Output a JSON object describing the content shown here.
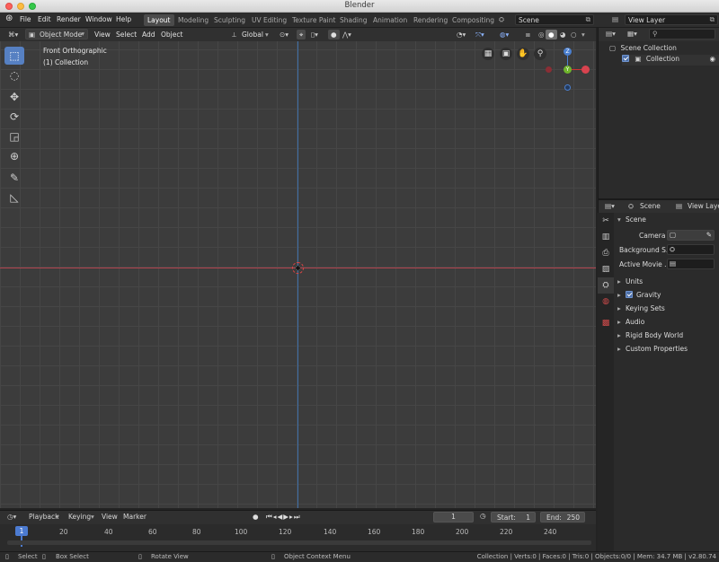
{
  "window": {
    "title": "Blender"
  },
  "menus": [
    "File",
    "Edit",
    "Render",
    "Window",
    "Help"
  ],
  "workspaces": [
    "Layout",
    "Modeling",
    "Sculpting",
    "UV Editing",
    "Texture Paint",
    "Shading",
    "Animation",
    "Rendering",
    "Compositing"
  ],
  "scene": {
    "name": "Scene"
  },
  "view_layer": {
    "name": "View Layer"
  },
  "viewport_header": {
    "mode": "Object Mode",
    "menus": [
      "View",
      "Select",
      "Add",
      "Object"
    ],
    "orientation": "Global"
  },
  "viewport": {
    "view_name": "Front Orthographic",
    "collection": "(1) Collection"
  },
  "gizmo": {
    "z": "Z",
    "y": "Y"
  },
  "outliner": {
    "search_placeholder": "",
    "items": [
      "Scene Collection",
      "Collection"
    ]
  },
  "properties": {
    "tabs": [
      "Scene",
      "View Layer"
    ],
    "panel_title": "Scene",
    "camera_label": "Camera",
    "background_label": "Background S...",
    "movie_label": "Active Movie ...",
    "sections": [
      "Units",
      "Gravity",
      "Keying Sets",
      "Audio",
      "Rigid Body World",
      "Custom Properties"
    ]
  },
  "timeline": {
    "menus": [
      "Playback",
      "Keying",
      "View",
      "Marker"
    ],
    "current_frame": "1",
    "start_label": "Start:",
    "start": "1",
    "end_label": "End:",
    "end": "250",
    "ticks": [
      "1",
      "20",
      "40",
      "60",
      "80",
      "100",
      "120",
      "140",
      "160",
      "180",
      "200",
      "220",
      "240"
    ]
  },
  "statusbar": {
    "select": "Select",
    "box_select": "Box Select",
    "rotate": "Rotate View",
    "context": "Object Context Menu",
    "stats": "Collection | Verts:0 | Faces:0 | Tris:0 | Objects:0/0 | Mem: 34.7 MB | v2.80.74"
  }
}
